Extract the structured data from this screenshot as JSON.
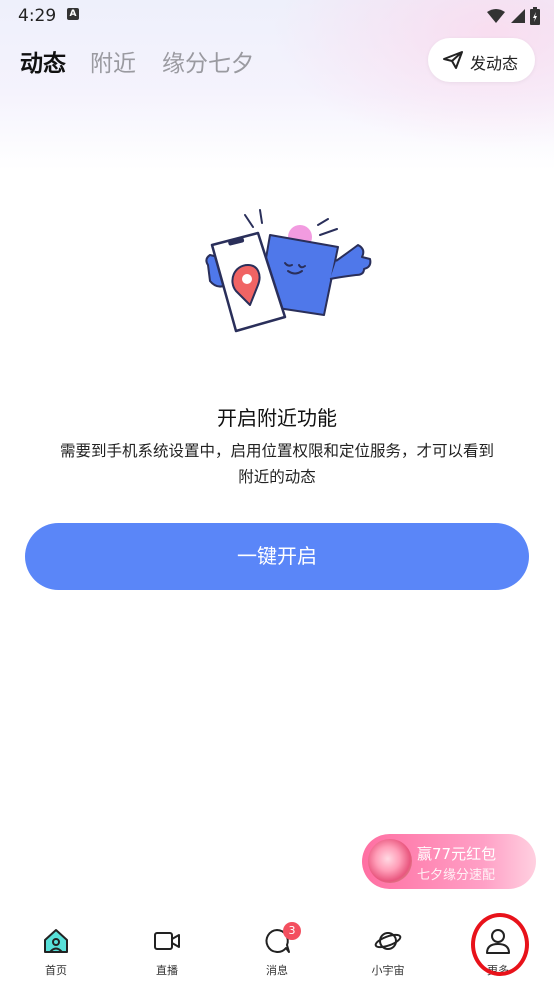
{
  "status_bar": {
    "time": "4:29",
    "notification_letter": "A"
  },
  "header": {
    "tabs": [
      {
        "label": "动态",
        "active": true
      },
      {
        "label": "附近",
        "active": false
      },
      {
        "label": "缘分七夕",
        "active": false
      }
    ],
    "post_button": {
      "label": "发动态",
      "icon": "send-icon"
    }
  },
  "empty_state": {
    "illustration": "location-phone-illustration",
    "title": "开启附近功能",
    "description": "需要到手机系统设置中，启用位置权限和定位服务，才可以看到附近的动态",
    "button_label": "一键开启"
  },
  "promo": {
    "line1": "赢77元红包",
    "line2": "七夕缘分速配"
  },
  "bottom_nav": {
    "items": [
      {
        "label": "首页",
        "icon": "home-icon",
        "active": true
      },
      {
        "label": "直播",
        "icon": "video-camera-icon"
      },
      {
        "label": "消息",
        "icon": "chat-bubble-icon",
        "badge": "3"
      },
      {
        "label": "小宇宙",
        "icon": "planet-icon"
      },
      {
        "label": "更多",
        "icon": "person-icon"
      }
    ]
  },
  "colors": {
    "accent": "#5a86f8",
    "badge": "#f34f5f",
    "highlight_circle": "#e8121a"
  }
}
